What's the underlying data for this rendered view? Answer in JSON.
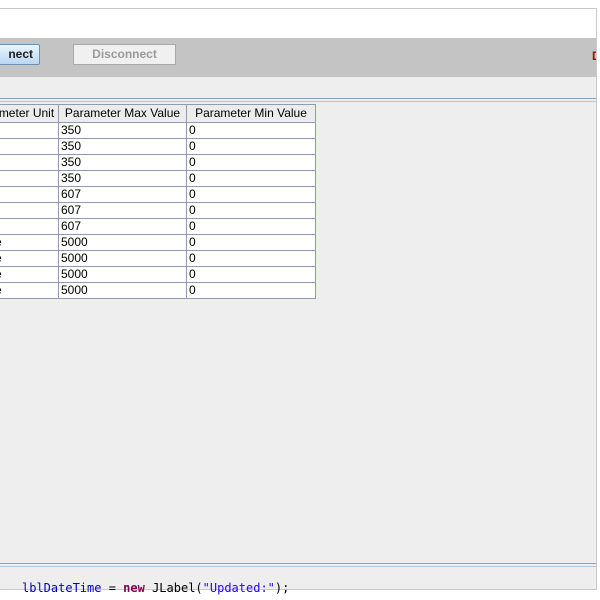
{
  "toolbar": {
    "connect_label": "nect",
    "disconnect_label": "Disconnect",
    "status_text": "D"
  },
  "table": {
    "headers": [
      "meter Unit",
      "Parameter Max Value",
      "Parameter Min Value"
    ],
    "rows": [
      [
        "",
        "350",
        "0"
      ],
      [
        "",
        "350",
        "0"
      ],
      [
        "",
        "350",
        "0"
      ],
      [
        "",
        "350",
        "0"
      ],
      [
        "",
        "607",
        "0"
      ],
      [
        "",
        "607",
        "0"
      ],
      [
        "",
        "607",
        "0"
      ],
      [
        "e",
        "5000",
        "0"
      ],
      [
        "e",
        "5000",
        "0"
      ],
      [
        "e",
        "5000",
        "0"
      ],
      [
        "e",
        "5000",
        "0"
      ]
    ]
  },
  "code": {
    "var": "lblDateTime",
    "assign": " = ",
    "kw": "new",
    "cls": " JLabel(",
    "str": "\"Updated:\"",
    "end": ");"
  },
  "colors": {
    "toolbar_bg": "#c4c4c4",
    "window_bg": "#eeeeee",
    "status_color": "#b30000",
    "separator": "#8aa2ba"
  }
}
